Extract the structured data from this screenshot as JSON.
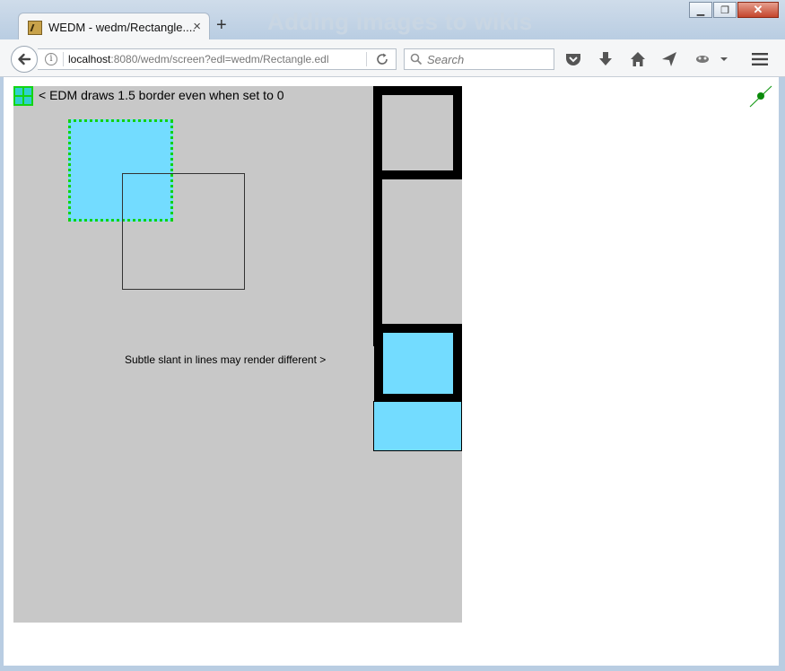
{
  "window": {
    "ghost_title": "Adding images to wikis",
    "minimize": "▁",
    "maximize": "❐",
    "close": "✕"
  },
  "tabs": [
    {
      "title": "WEDM - wedm/Rectangle....",
      "close": "×"
    }
  ],
  "new_tab": "+",
  "navbar": {
    "url_host": "localhost",
    "url_rest": ":8080/wedm/screen?edl=wedm/Rectangle.edl",
    "search_placeholder": "Search",
    "icons": [
      "back-icon",
      "info-icon",
      "reload-icon",
      "search-icon",
      "pocket-icon",
      "download-icon",
      "home-icon",
      "send-icon",
      "extension-icon",
      "dropdown-icon",
      "menu-icon"
    ]
  },
  "edm": {
    "label_border": "< EDM draws 1.5 border even when set to 0",
    "label_slant": "Subtle slant in lines may render different >"
  },
  "colors": {
    "screen_bg": "#c8c8c8",
    "fill_blue": "#73dcff",
    "dotted_green": "#12d212"
  }
}
